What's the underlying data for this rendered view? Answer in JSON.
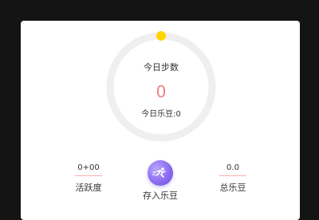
{
  "steps": {
    "label": "今日步数",
    "value": "0",
    "beans_today": "今日乐豆:0"
  },
  "stats": {
    "activity_value": "0+00",
    "activity_label": "活跃度",
    "total_value": "0.0",
    "total_label": "总乐豆"
  },
  "deposit": {
    "label": "存入乐豆",
    "icon": "runner-icon"
  },
  "colors": {
    "ring": "#efefef",
    "ring_dot": "#ffd400",
    "steps_value": "#f08080",
    "accent_purple": "#8b6cf0"
  }
}
